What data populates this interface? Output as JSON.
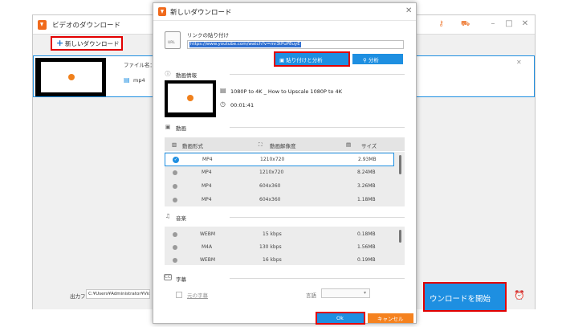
{
  "main_window": {
    "title": "ビデオのダウンロード",
    "new_download_label": "新しいダウンロード",
    "task": {
      "filename_label": "ファイル名：",
      "format": "mp4"
    },
    "output_folder_label": "出力フォルダ：",
    "output_path": "C:¥Users¥Administrator¥Vid",
    "start_download_label": "ウンロードを開始"
  },
  "dialog": {
    "title": "新しいダウンロード",
    "url_icon_text": "URL",
    "paste_link_label": "リンクの貼り付け",
    "url_value": "https://www.youtube.com/watch?v=mr3tPuP8uyE",
    "paste_analyze_label": "貼り付けと分析",
    "analyze_label": "分析",
    "video_info": {
      "header": "動画情報",
      "title": "1080P to 4K _ How to Upscale 1080P to 4K",
      "duration": "00:01:41"
    },
    "video": {
      "header": "動画",
      "columns": [
        "動画形式",
        "動画解像度",
        "サイズ"
      ],
      "rows": [
        {
          "format": "MP4",
          "resolution": "1210x720",
          "size": "2.93MB",
          "selected": true
        },
        {
          "format": "MP4",
          "resolution": "1210x720",
          "size": "8.24MB",
          "selected": false
        },
        {
          "format": "MP4",
          "resolution": "604x360",
          "size": "3.26MB",
          "selected": false
        },
        {
          "format": "MP4",
          "resolution": "604x360",
          "size": "1.18MB",
          "selected": false
        }
      ]
    },
    "audio": {
      "header": "音楽",
      "rows": [
        {
          "format": "WEBM",
          "bitrate": "15 kbps",
          "size": "0.18MB"
        },
        {
          "format": "M4A",
          "bitrate": "130 kbps",
          "size": "1.56MB"
        },
        {
          "format": "WEBM",
          "bitrate": "16 kbps",
          "size": "0.19MB"
        }
      ]
    },
    "subtitles": {
      "header": "字幕",
      "original_label": "元の字幕",
      "language_label": "言語",
      "language_value": ""
    },
    "ok_label": "Ok",
    "cancel_label": "キャンセル"
  },
  "colors": {
    "accent": "#1e8fe1",
    "highlight": "#e20000",
    "brand": "#f06a1c",
    "cancel": "#f5821f"
  }
}
